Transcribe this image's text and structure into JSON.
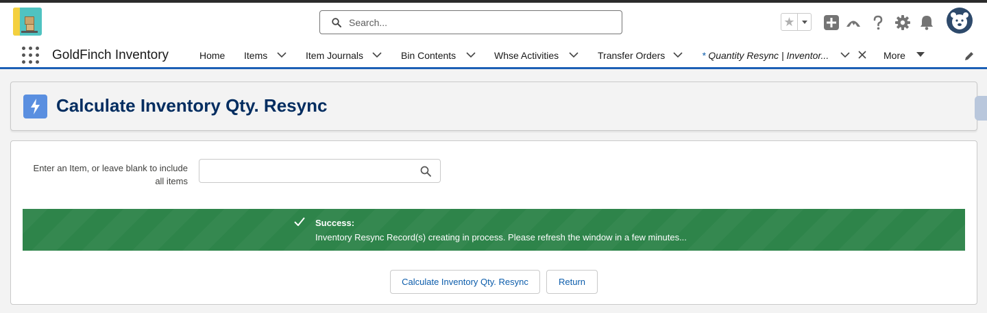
{
  "header": {
    "app_logo": "goldfinch-logo",
    "search": {
      "placeholder": "Search..."
    },
    "icons": [
      "favorite-star-icon",
      "add-icon",
      "trailhead-icon",
      "help-icon",
      "settings-icon",
      "notification-bell-icon",
      "user-avatar"
    ]
  },
  "nav": {
    "app_name": "GoldFinch Inventory",
    "items": [
      {
        "label": "Home"
      },
      {
        "label": "Items"
      },
      {
        "label": "Item Journals"
      },
      {
        "label": "Bin Contents"
      },
      {
        "label": "Whse Activities"
      },
      {
        "label": "Transfer Orders"
      },
      {
        "asterisk": "*",
        "label": " Quantity Resync | Inventor..."
      },
      {
        "label": "More"
      }
    ]
  },
  "page": {
    "title": "Calculate Inventory Qty. Resync",
    "field_label": "Enter an Item, or leave blank to include all items",
    "field_value": ""
  },
  "toast": {
    "title": "Success:",
    "message": "Inventory Resync Record(s) creating in process. Please refresh the window in a few minutes...",
    "color": "#2e844a"
  },
  "buttons": {
    "calculate": "Calculate Inventory Qty. Resync",
    "return": "Return"
  },
  "colors": {
    "brand": "#0b5cab",
    "nav_underline": "#1b5fb5",
    "title": "#032d60",
    "title_icon": "#5a8fe0"
  }
}
